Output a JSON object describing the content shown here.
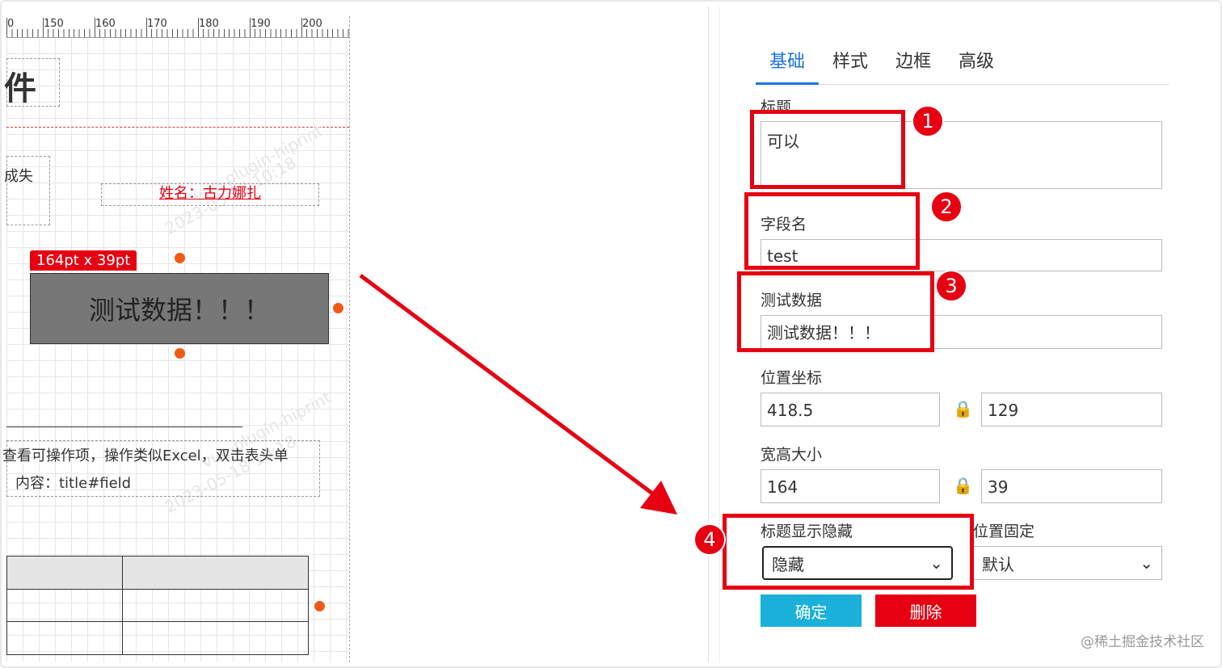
{
  "canvas": {
    "ruler_labels": [
      "0",
      "150",
      "160",
      "170",
      "180",
      "190",
      "200"
    ],
    "title_fragment": "件",
    "left_fragment": "成失",
    "name_text": "姓名：古力娜扎",
    "watermark_1": "vue-plugin-hiprint",
    "watermark_2": "2023-05-18 10:18",
    "size_badge": "164pt x 39pt",
    "selected_text": "测试数据！！！",
    "desc_line1": "查看可操作项，操作类似Excel，双击表头单",
    "desc_line2": "内容：title#field"
  },
  "panel": {
    "tabs": [
      {
        "label": "基础",
        "active": true
      },
      {
        "label": "样式",
        "active": false
      },
      {
        "label": "边框",
        "active": false
      },
      {
        "label": "高级",
        "active": false
      }
    ],
    "title_label": "标题",
    "title_value": "可以",
    "field_label": "字段名",
    "field_value": "test",
    "testdata_label": "测试数据",
    "testdata_value": "测试数据！！！",
    "position_label": "位置坐标",
    "pos_x": "418.5",
    "pos_y": "129",
    "size_label": "宽高大小",
    "width": "164",
    "height": "39",
    "title_visibility_label": "标题显示隐藏",
    "title_visibility_value": "隐藏",
    "position_fixed_label": "位置固定",
    "position_fixed_value": "默认",
    "confirm_label": "确定",
    "delete_label": "删除"
  },
  "annotations": [
    "1",
    "2",
    "3",
    "4"
  ],
  "footer": "@稀土掘金技术社区",
  "colors": {
    "accent": "#1a73e8",
    "annotation_red": "#e60012",
    "confirm": "#1ab0d9",
    "handle": "#f05a16"
  },
  "icons": [
    "lock-icon",
    "chevron-down-icon",
    "arrow-icon"
  ]
}
